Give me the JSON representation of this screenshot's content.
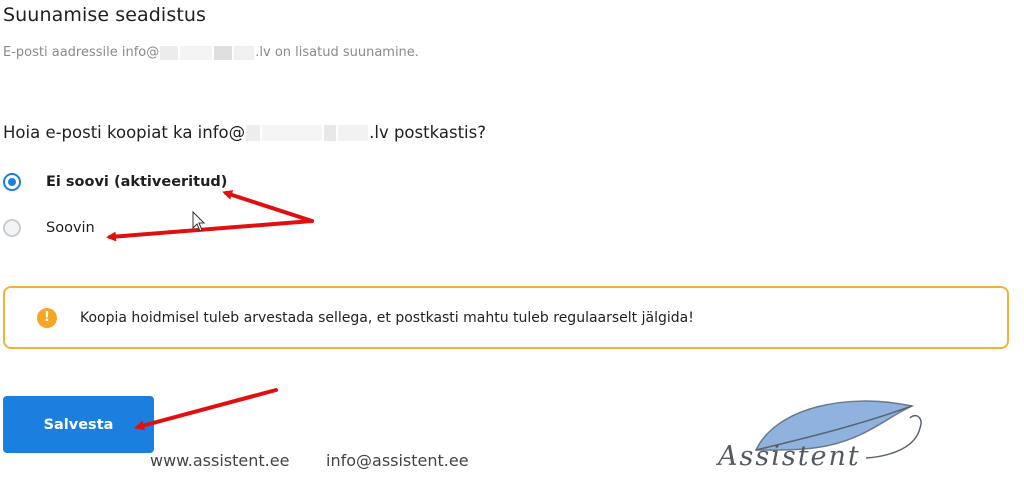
{
  "header": {
    "title": "Suunamise seadistus",
    "subtitle_prefix": "E-posti aadressile info@",
    "subtitle_suffix": ".lv on lisatud suunamine."
  },
  "question": {
    "prefix": "Hoia e-posti koopiat ka info@",
    "suffix": ".lv postkastis?"
  },
  "options": [
    {
      "label": "Ei soovi (aktiveeritud)",
      "checked": true
    },
    {
      "label": "Soovin",
      "checked": false
    }
  ],
  "alert": {
    "icon": "!",
    "text": "Koopia hoidmisel tuleb arvestada sellega, et postkasti mahtu tuleb regulaarselt jälgida!",
    "border_color": "#f2b13a",
    "icon_color": "#f5a623"
  },
  "save_button": {
    "label": "Salvesta",
    "color": "#1b7fe0"
  },
  "footer": {
    "website": "www.assistent.ee",
    "email": "info@assistent.ee"
  },
  "logo": {
    "text": "Assistent"
  },
  "annotation_color": "#e01010"
}
